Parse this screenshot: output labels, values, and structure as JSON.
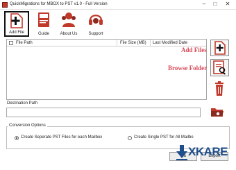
{
  "window": {
    "title": "QuickMigrations for MBOX to PST v1.0 - Full Version",
    "min": "–",
    "max": "□",
    "close": "✕"
  },
  "toolbar": {
    "items": [
      {
        "label": "Add File",
        "icon": "add-file-icon"
      },
      {
        "label": "Guide",
        "icon": "guide-book-icon"
      },
      {
        "label": "About Us",
        "icon": "about-us-icon"
      },
      {
        "label": "Support",
        "icon": "headset-icon"
      }
    ]
  },
  "file_table": {
    "columns": [
      "File Path",
      "File Size (MB)",
      "Last Modified Date"
    ],
    "rows": []
  },
  "side_buttons": [
    {
      "icon": "add-file-icon"
    },
    {
      "icon": "browse-folder-icon"
    },
    {
      "icon": "trash-icon"
    }
  ],
  "overlay_labels": {
    "add_files": "Add Files",
    "browse_folder": "Browse Folder"
  },
  "destination": {
    "label": "Destination Path",
    "value": "",
    "browse_icon": "folder-icon"
  },
  "conversion": {
    "title": "Conversion Options",
    "options": [
      {
        "label": "Create Seperate PST Files for each Mailbox",
        "checked": true
      },
      {
        "label": "Create Single PST for All Mailbo",
        "checked": false
      }
    ]
  },
  "buttons": {
    "cancel": "Ca",
    "export": "Export"
  },
  "watermark": {
    "text": "XKARE"
  },
  "colors": {
    "accent_red": "#c0392b",
    "label_pink": "#d94a5a",
    "watermark_blue": "#1f4e8c"
  }
}
